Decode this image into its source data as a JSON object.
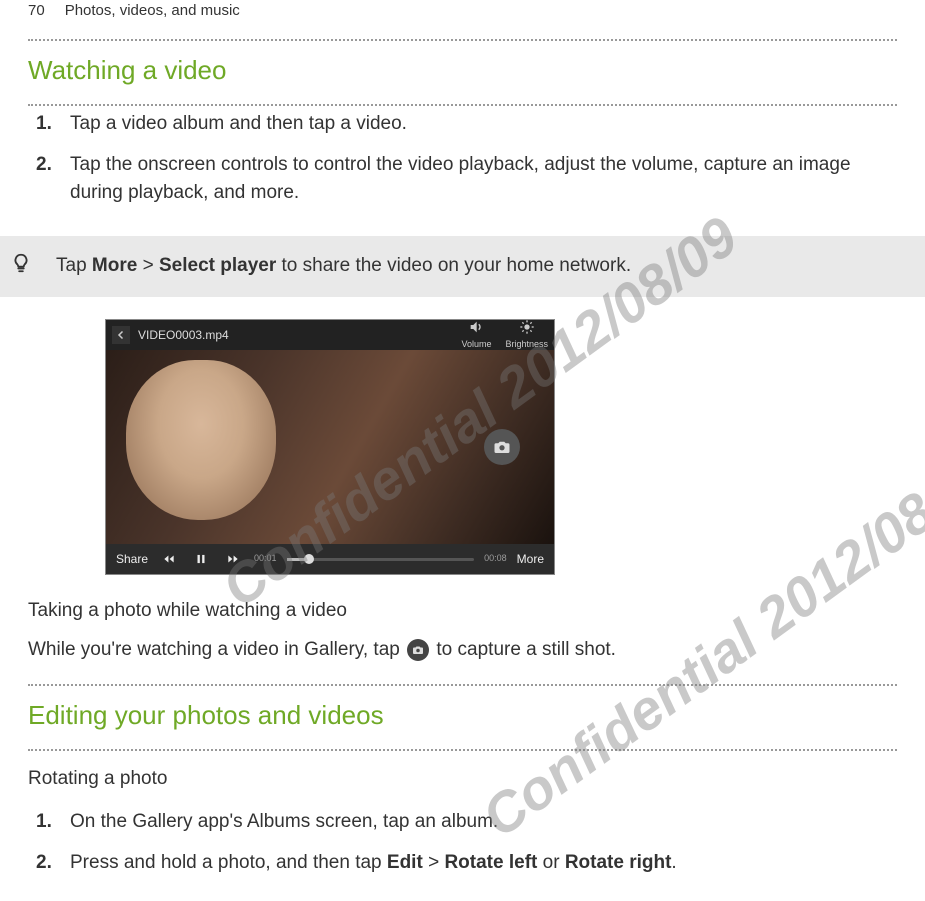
{
  "header": {
    "page_number": "70",
    "section_title": "Photos, videos, and music"
  },
  "watching": {
    "heading": "Watching a video",
    "steps": [
      "Tap a video album and then tap a video.",
      "Tap the onscreen controls to control the video playback, adjust the volume, capture an image during playback, and more."
    ]
  },
  "tip": {
    "pre": "Tap ",
    "b1": "More",
    "mid1": " > ",
    "b2": "Select player",
    "post": " to share the video on your home network."
  },
  "screenshot": {
    "filename": "VIDEO0003.mp4",
    "volume_label": "Volume",
    "brightness_label": "Brightness",
    "share_label": "Share",
    "more_label": "More",
    "elapsed": "00:01",
    "duration": "00:08"
  },
  "taking_photo": {
    "heading": "Taking a photo while watching a video",
    "pre": "While you're watching a video in Gallery, tap ",
    "post": " to capture a still shot."
  },
  "editing": {
    "heading": "Editing your photos and videos",
    "sub": "Rotating a photo",
    "steps": {
      "s1": "On the Gallery app's Albums screen, tap an album.",
      "s2_pre": "Press and hold a photo, and then tap ",
      "s2_b1": "Edit",
      "s2_mid1": " > ",
      "s2_b2": "Rotate left",
      "s2_mid2": " or ",
      "s2_b3": "Rotate right",
      "s2_post": "."
    }
  },
  "watermark": "Confidential  2012/08/09"
}
